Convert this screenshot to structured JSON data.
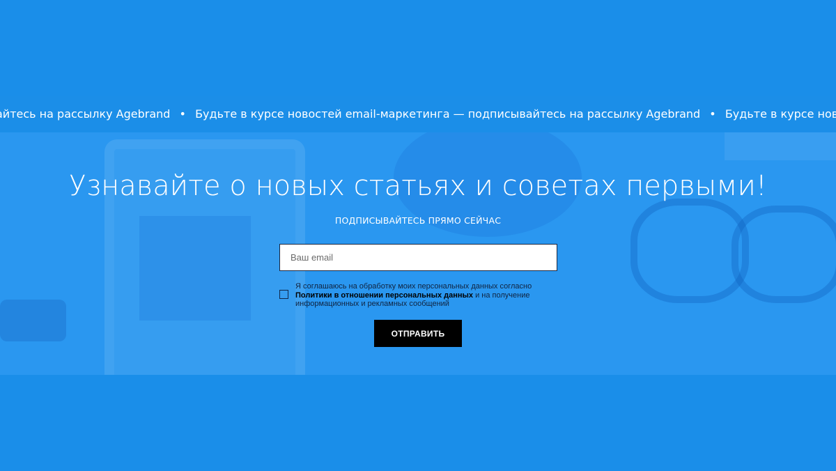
{
  "ticker": {
    "segments": [
      "айтесь на рассылку Agebrand",
      "•",
      "Будьте в курсе новостей email-маркетинга — подписывайтесь на рассылку Agebrand",
      "•",
      "Будьте в курсе новостей email-маркетинга"
    ]
  },
  "subscribe": {
    "headline": "Узнавайте о новых статьях и советах первыми!",
    "subheadline": "ПОДПИСЫВАЙТЕСЬ ПРЯМО СЕЙЧАС",
    "email_placeholder": "Ваш email",
    "email_value": "",
    "consent": {
      "checked": false,
      "text_before": "Я соглашаюсь на обработку моих персональных данных согласно",
      "link_text": "Политики в отношении персональных данных",
      "text_after": "и на получение информационных и рекламных сообщений"
    },
    "submit_label": "ОТПРАВИТЬ"
  },
  "colors": {
    "background": "#1a8ee9",
    "hero_background": "#2a97f0",
    "button": "#000000",
    "checkbox_border": "#10274a"
  },
  "icons": {
    "ticker_separator": "bullet"
  }
}
